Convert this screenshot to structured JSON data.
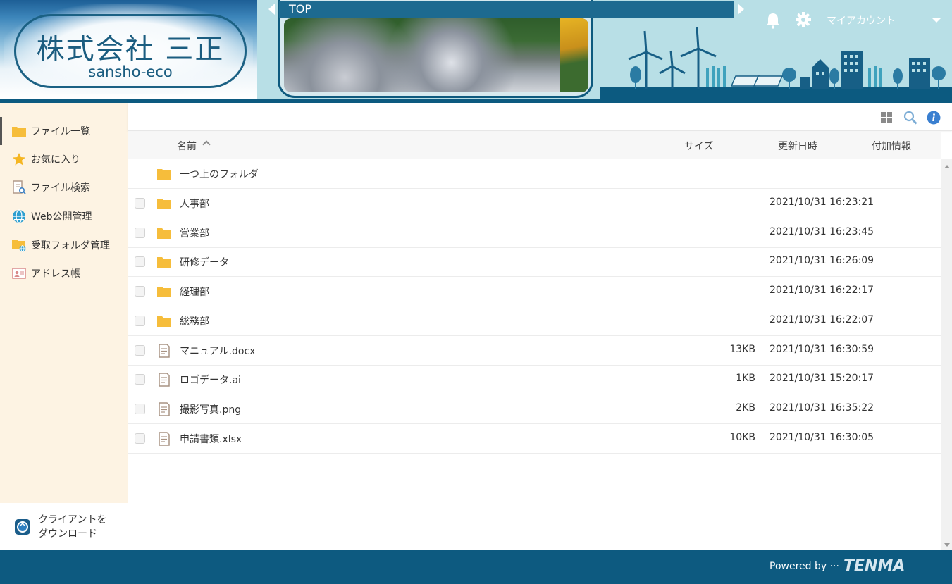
{
  "header": {
    "logo_jp": "株式会社 三正",
    "logo_en": "sansho-eco",
    "breadcrumb": "TOP",
    "account_label": "マイアカウント",
    "icons": [
      "bell-icon",
      "gear-icon",
      "chevron-down-icon"
    ]
  },
  "sidebar": {
    "items": [
      {
        "label": "ファイル一覧",
        "icon": "folder-icon",
        "active": true
      },
      {
        "label": "お気に入り",
        "icon": "star-icon"
      },
      {
        "label": "ファイル検索",
        "icon": "file-search-icon"
      },
      {
        "label": "Web公開管理",
        "icon": "globe-icon"
      },
      {
        "label": "受取フォルダ管理",
        "icon": "receive-folder-icon"
      },
      {
        "label": "アドレス帳",
        "icon": "address-book-icon"
      }
    ],
    "download_label": "クライアントをダウンロード"
  },
  "toolbar": {
    "icons": [
      "grid-view-icon",
      "search-icon",
      "info-icon"
    ]
  },
  "table": {
    "headers": {
      "name": "名前",
      "size": "サイズ",
      "updated": "更新日時",
      "extra": "付加情報"
    },
    "parent_row": "一つ上のフォルダ",
    "rows": [
      {
        "type": "folder",
        "name": "人事部",
        "size": "",
        "date": "2021/10/31 16:23:21"
      },
      {
        "type": "folder",
        "name": "営業部",
        "size": "",
        "date": "2021/10/31 16:23:45"
      },
      {
        "type": "folder",
        "name": "研修データ",
        "size": "",
        "date": "2021/10/31 16:26:09"
      },
      {
        "type": "folder",
        "name": "経理部",
        "size": "",
        "date": "2021/10/31 16:22:17"
      },
      {
        "type": "folder",
        "name": "総務部",
        "size": "",
        "date": "2021/10/31 16:22:07"
      },
      {
        "type": "file",
        "name": "マニュアル.docx",
        "size": "13KB",
        "date": "2021/10/31 16:30:59"
      },
      {
        "type": "file",
        "name": "ロゴデータ.ai",
        "size": "1KB",
        "date": "2021/10/31 15:20:17"
      },
      {
        "type": "file",
        "name": "撮影写真.png",
        "size": "2KB",
        "date": "2021/10/31 16:35:22"
      },
      {
        "type": "file",
        "name": "申請書類.xlsx",
        "size": "10KB",
        "date": "2021/10/31 16:30:05"
      }
    ]
  },
  "footer": {
    "powered": "Powered by ···",
    "brand": "TENMA"
  },
  "colors": {
    "header_bg": "#b8dfe6",
    "accent_dark": "#0d5a80",
    "sidebar_bg": "#fdf3e3",
    "folder": "#f6bd3b"
  }
}
